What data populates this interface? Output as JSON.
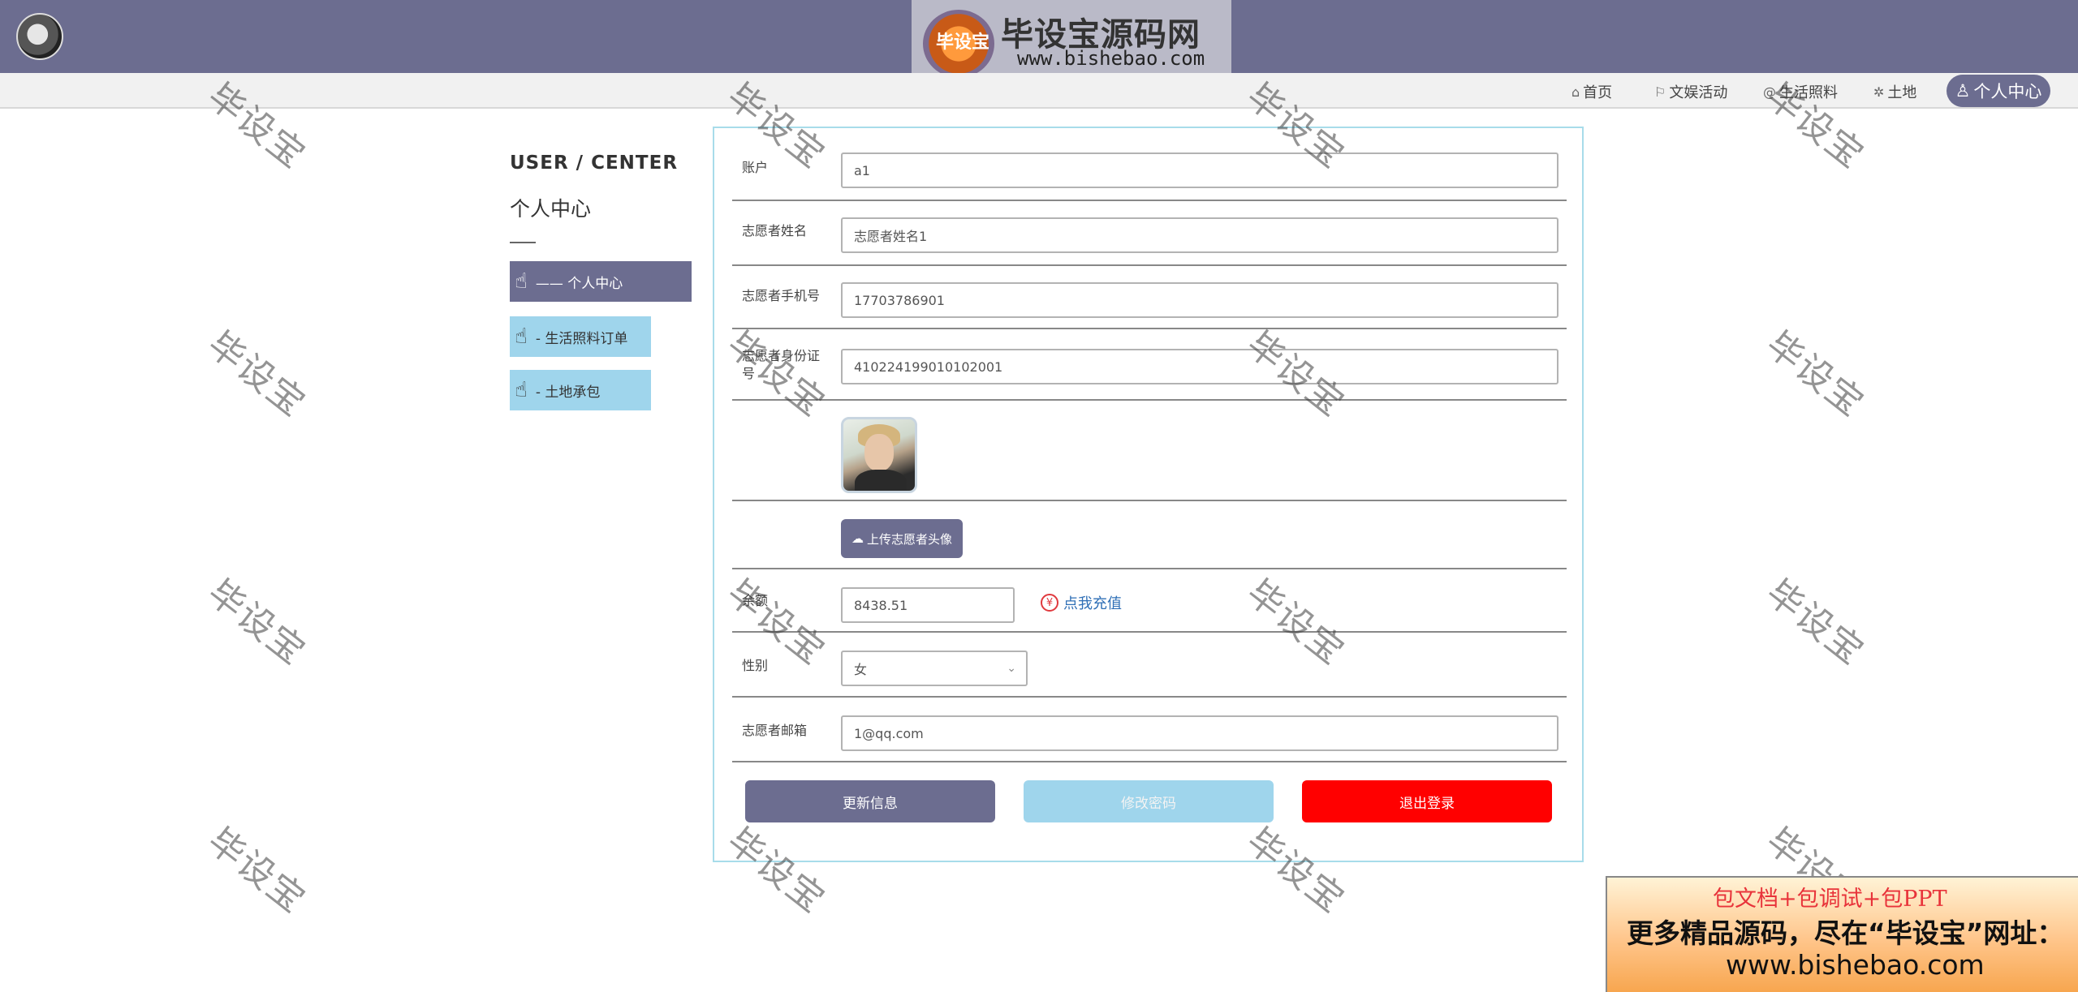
{
  "header": {
    "site_name": "毕设宝源码网",
    "site_url": "www.bishebao.com",
    "seal_text": "毕设宝"
  },
  "nav": {
    "items": [
      {
        "label": "首页",
        "icon": "home-icon"
      },
      {
        "label": "文娱活动",
        "icon": "flag-icon"
      },
      {
        "label": "生活照料",
        "icon": "at-icon"
      },
      {
        "label": "土地",
        "icon": "puzzle-icon"
      }
    ],
    "active": {
      "label": "个人中心",
      "icon": "user-icon"
    }
  },
  "sidebar": {
    "title_en": "USER / CENTER",
    "title_cn": "个人中心",
    "items": [
      {
        "label": "—— 个人中心"
      },
      {
        "label": "- 生活照料订单"
      },
      {
        "label": "- 土地承包"
      }
    ]
  },
  "form": {
    "account": {
      "label": "账户",
      "value": "a1"
    },
    "name": {
      "label": "志愿者姓名",
      "value": "志愿者姓名1"
    },
    "phone": {
      "label": "志愿者手机号",
      "value": "17703786901"
    },
    "idcard": {
      "label": "志愿者身份证号",
      "value": "410224199010102001"
    },
    "upload_label": "上传志愿者头像",
    "balance": {
      "label": "余额",
      "value": "8438.51",
      "recharge": "点我充值"
    },
    "gender": {
      "label": "性别",
      "value": "女"
    },
    "email": {
      "label": "志愿者邮箱",
      "value": "1@qq.com"
    },
    "buttons": {
      "update": "更新信息",
      "change_password": "修改密码",
      "logout": "退出登录"
    }
  },
  "watermark": "毕设宝",
  "promo": {
    "line1": "包文档+包调试+包PPT",
    "line2": "更多精品源码，尽在“毕设宝”网址：",
    "line3": "www.bishebao.com"
  },
  "colors": {
    "primary": "#6c6d90",
    "light_blue": "#9fd5ec",
    "danger": "#ff0000",
    "link": "#2f6fb6"
  }
}
